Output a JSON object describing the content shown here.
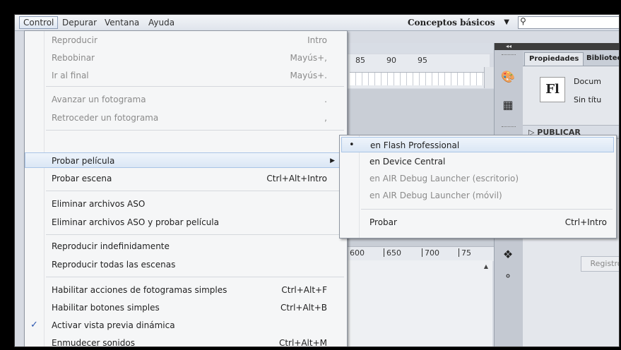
{
  "menubar": {
    "items": [
      "Control",
      "Depurar",
      "Ventana",
      "Ayuda"
    ],
    "workspace": "Conceptos básicos",
    "search_icon": "search-icon"
  },
  "background": {
    "ruler_numbers": [
      "85",
      "90",
      "95"
    ],
    "stage_ruler_numbers": [
      "600",
      "650",
      "700",
      "75"
    ]
  },
  "right_panel": {
    "tabs": [
      "Propiedades",
      "Biblioteca"
    ],
    "logo": "Fl",
    "doc_label": "Docum",
    "doc_sub": "Sin títu",
    "publish": "PUBLICAR",
    "registro": "Registro"
  },
  "menu": {
    "items": [
      {
        "label": "Reproducir",
        "shortcut": "Intro"
      },
      {
        "label": "Rebobinar",
        "shortcut": "Mayús+,"
      },
      {
        "label": "Ir al final",
        "shortcut": "Mayús+."
      },
      {
        "label": "Avanzar un fotograma",
        "shortcut": "."
      },
      {
        "label": "Retroceder un fotograma",
        "shortcut": ","
      },
      {
        "label": "Probar película",
        "shortcut": ""
      },
      {
        "label": "Probar escena",
        "shortcut": "Ctrl+Alt+Intro"
      },
      {
        "label": "Eliminar archivos ASO",
        "shortcut": ""
      },
      {
        "label": "Eliminar archivos ASO y probar película",
        "shortcut": ""
      },
      {
        "label": "Reproducir indefinidamente",
        "shortcut": ""
      },
      {
        "label": "Reproducir todas las escenas",
        "shortcut": ""
      },
      {
        "label": "Habilitar acciones de fotogramas simples",
        "shortcut": "Ctrl+Alt+F"
      },
      {
        "label": "Habilitar botones simples",
        "shortcut": "Ctrl+Alt+B"
      },
      {
        "label": "Activar vista previa dinámica",
        "shortcut": ""
      },
      {
        "label": "Enmudecer sonidos",
        "shortcut": "Ctrl+Alt+M"
      }
    ]
  },
  "submenu": {
    "items": [
      {
        "label": "en Flash Professional",
        "shortcut": ""
      },
      {
        "label": "en Device Central",
        "shortcut": ""
      },
      {
        "label": "en AIR Debug Launcher (escritorio)",
        "shortcut": ""
      },
      {
        "label": "en AIR Debug Launcher (móvil)",
        "shortcut": ""
      },
      {
        "label": "Probar",
        "shortcut": "Ctrl+Intro"
      }
    ]
  }
}
